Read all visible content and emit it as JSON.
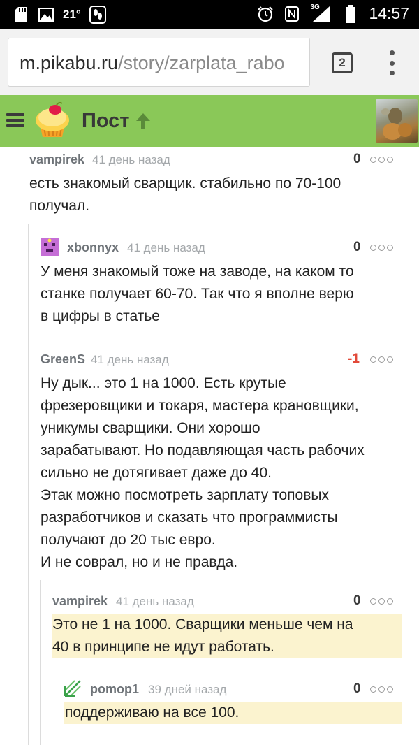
{
  "status_bar": {
    "temperature": "21°",
    "network": "3G",
    "time": "14:57",
    "icons": [
      "sd-card-icon",
      "image-icon",
      "footprint-icon",
      "alarm-icon",
      "nfc-icon",
      "signal-icon",
      "battery-icon"
    ]
  },
  "browser": {
    "url_host": "m.pikabu.ru",
    "url_path": "/story/zarplata_rabo",
    "tab_count": "2",
    "icons": [
      "menu-dots-icon"
    ]
  },
  "header": {
    "title": "Пост",
    "colors": {
      "header_bg": "#8ac858",
      "title": "#383838",
      "arrow": "#5a8a3a"
    },
    "icons": [
      "hamburger-icon",
      "pikabu-logo",
      "arrow-up-icon",
      "user-avatar"
    ]
  },
  "comments": [
    {
      "user": "vampirek",
      "time": "41 день назад",
      "rating": "0",
      "lines": [
        "есть знакомый сварщик. стабильно по 70-100",
        "получал."
      ],
      "highlight": false
    },
    {
      "user": "xbonnyx",
      "time": "41 день назад",
      "rating": "0",
      "lines": [
        "У меня знакомый тоже на заводе, на каком то",
        "станке получает 60-70. Так что я вполне верю",
        "в цифры в статье"
      ],
      "highlight": false
    },
    {
      "user": "GreenS",
      "time": "41 день назад",
      "rating": "-1",
      "lines": [
        "Ну дык... это 1 на 1000. Есть крутые",
        "фрезеровщики и токаря, мастера крановщики,",
        "уникумы сварщики. Они хорошо",
        "зарабатывают. Но подавляющая часть рабочих",
        "сильно не дотягивает даже до 40.",
        "Этак можно посмотреть зарплату топовых",
        "разработчиков и сказать что программисты",
        "получают до 20 тыс евро.",
        "И не соврал, но и не правда."
      ],
      "highlight": false
    },
    {
      "user": "vampirek",
      "time": "41 день назад",
      "rating": "0",
      "lines": [
        "Это не 1 на 1000. Сварщики меньше чем на",
        "40 в принципе не идут работать."
      ],
      "highlight": true
    },
    {
      "user": "pomop1",
      "time": "39 дней назад",
      "rating": "0",
      "lines": [
        "поддерживаю на все 100."
      ],
      "highlight": true
    }
  ],
  "colors": {
    "negative_rating": "#e24a3a",
    "highlight": "#fbf3cf",
    "username": "#6e7378",
    "meta": "#a4a8ab"
  }
}
